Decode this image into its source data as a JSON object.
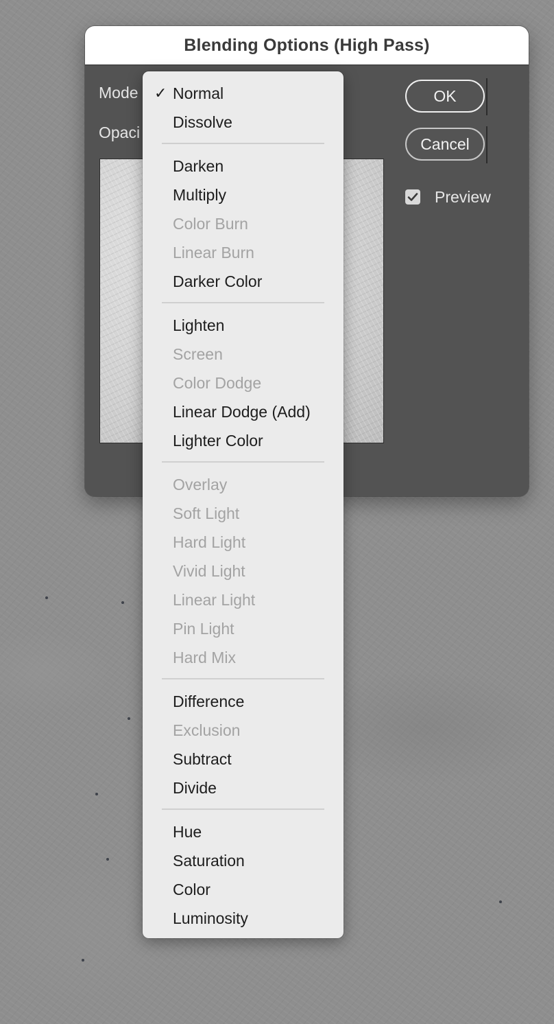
{
  "dialog": {
    "title": "Blending Options (High Pass)",
    "mode_label": "Mode",
    "opacity_label": "Opaci",
    "ok_label": "OK",
    "cancel_label": "Cancel",
    "preview_label": "Preview",
    "preview_checked": true
  },
  "menu": {
    "selected": "Normal",
    "check_glyph": "✓",
    "items": [
      {
        "label": "Normal",
        "enabled": true
      },
      {
        "label": "Dissolve",
        "enabled": true
      },
      {
        "label": "Darken",
        "enabled": true
      },
      {
        "label": "Multiply",
        "enabled": true
      },
      {
        "label": "Color Burn",
        "enabled": false
      },
      {
        "label": "Linear Burn",
        "enabled": false
      },
      {
        "label": "Darker Color",
        "enabled": true
      },
      {
        "label": "Lighten",
        "enabled": true
      },
      {
        "label": "Screen",
        "enabled": false
      },
      {
        "label": "Color Dodge",
        "enabled": false
      },
      {
        "label": "Linear Dodge (Add)",
        "enabled": true
      },
      {
        "label": "Lighter Color",
        "enabled": true
      },
      {
        "label": "Overlay",
        "enabled": false
      },
      {
        "label": "Soft Light",
        "enabled": false
      },
      {
        "label": "Hard Light",
        "enabled": false
      },
      {
        "label": "Vivid Light",
        "enabled": false
      },
      {
        "label": "Linear Light",
        "enabled": false
      },
      {
        "label": "Pin Light",
        "enabled": false
      },
      {
        "label": "Hard Mix",
        "enabled": false
      },
      {
        "label": "Difference",
        "enabled": true
      },
      {
        "label": "Exclusion",
        "enabled": false
      },
      {
        "label": "Subtract",
        "enabled": true
      },
      {
        "label": "Divide",
        "enabled": true
      },
      {
        "label": "Hue",
        "enabled": true
      },
      {
        "label": "Saturation",
        "enabled": true
      },
      {
        "label": "Color",
        "enabled": true
      },
      {
        "label": "Luminosity",
        "enabled": true
      }
    ]
  }
}
